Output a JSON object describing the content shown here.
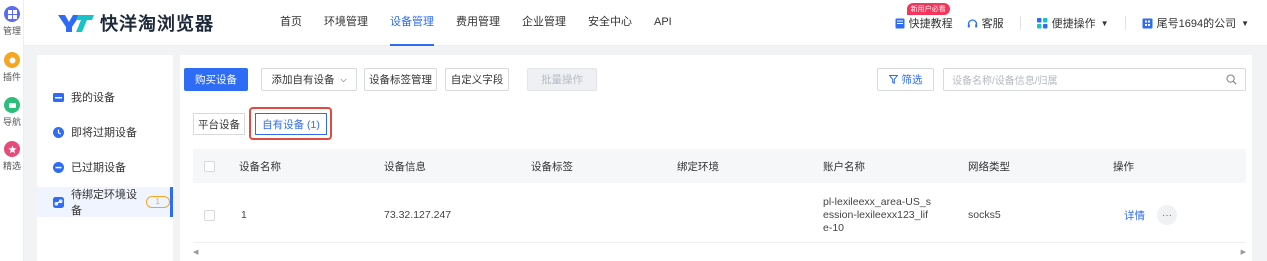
{
  "rail": [
    {
      "label": "管理",
      "icon": "grid-icon",
      "color": "#5b6cf2"
    },
    {
      "label": "插件",
      "icon": "plugin-icon",
      "color": "#f5a623"
    },
    {
      "label": "导航",
      "icon": "compass-icon",
      "color": "#2bbf7a"
    },
    {
      "label": "精选",
      "icon": "star-icon",
      "color": "#e84a7a"
    }
  ],
  "header": {
    "brand": "快洋淘浏览器",
    "nav": [
      "首页",
      "环境管理",
      "设备管理",
      "费用管理",
      "企业管理",
      "安全中心",
      "API"
    ],
    "active_nav": "设备管理",
    "tutorial_badge": "新用户必看",
    "tutorial": "快捷教程",
    "service": "客服",
    "quick_ops": "便捷操作",
    "company": "尾号1694的公司"
  },
  "sidebar": {
    "items": [
      {
        "label": "我的设备",
        "icon": "device-icon"
      },
      {
        "label": "即将过期设备",
        "icon": "clock-icon"
      },
      {
        "label": "已过期设备",
        "icon": "expired-icon"
      },
      {
        "label": "待绑定环境设备",
        "icon": "link-icon",
        "badge": "1"
      }
    ]
  },
  "toolbar": {
    "buy": "购买设备",
    "add_own": "添加自有设备",
    "tag_manage": "设备标签管理",
    "custom_field": "自定义字段",
    "batch": "批量操作",
    "filter": "筛选",
    "search_placeholder": "设备名称/设备信息/归属"
  },
  "tabs": {
    "platform": "平台设备",
    "own": "自有设备 (1)"
  },
  "table": {
    "columns": [
      "设备名称",
      "设备信息",
      "设备标签",
      "绑定环境",
      "账户名称",
      "网络类型",
      "操作"
    ],
    "rows": [
      {
        "name": "1",
        "info": "73.32.127.247",
        "tag": "",
        "env": "",
        "account": "pl-lexileexx_area-US_session-lexileexx123_life-10",
        "network": "socks5",
        "action": "详情",
        "more": "···"
      }
    ]
  },
  "colors": {
    "accent": "#2f6cf6",
    "highlight": "#e04a3f",
    "badge": "#f5a623"
  }
}
